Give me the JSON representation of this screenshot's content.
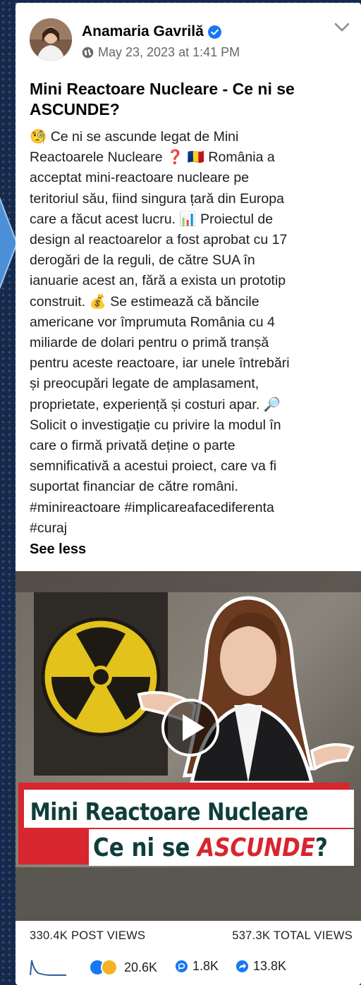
{
  "post": {
    "author": "Anamaria Gavrilă",
    "timestamp": "May 23, 2023 at 1:41 PM",
    "title": "Mini Reactoare Nucleare - Ce ni se ASCUNDE?",
    "body": "🧐 Ce ni se ascunde legat de Mini\nReactoarele Nucleare ❓ 🇷🇴 România a\nacceptat mini-reactoare nucleare pe\nteritoriul său, fiind singura țară din Europa\ncare a făcut acest lucru. 📊 Proiectul de\ndesign al reactoarelor a fost aprobat cu 17\nderogări de la reguli, de către SUA în\nianuarie acest an, fără a exista un prototip\nconstruit. 💰 Se estimează că băncile\namericane vor împrumuta România cu 4\nmiliarde de dolari pentru o primă tranșă\npentru aceste reactoare, iar unele întrebări\nși preocupări legate de amplasament,\nproprietate, experiență și costuri apar. 🔎\nSolicit o investigație cu privire la modul în\ncare o firmă privată deține o parte\nsemnificativă a acestui proiect, care va fi\nsuportat financiar de către români.\n#minireactoare #implicareafacediferenta\n#curaj",
    "see_less": "See less"
  },
  "video": {
    "caption_line1": "Mini Reactoare Nucleare",
    "caption_line2_prefix": "Ce ni se ",
    "caption_line2_highlight": "ASCUNDE",
    "caption_line2_suffix": "?"
  },
  "stats": {
    "post_views": "330.4K POST VIEWS",
    "total_views": "537.3K TOTAL VIEWS"
  },
  "engagement": {
    "reactions": "20.6K",
    "comments": "1.8K",
    "shares": "13.8K"
  },
  "colors": {
    "verified_blue": "#1877f2",
    "caption_teal": "#0f3d3a",
    "caption_red": "#d7262e",
    "radiation_yellow": "#e2c21b"
  },
  "icons": [
    "verified-icon",
    "globe-icon",
    "chevron-down-icon",
    "play-icon",
    "sparkline-icon",
    "like-icon",
    "haha-icon",
    "comment-icon",
    "share-icon"
  ]
}
